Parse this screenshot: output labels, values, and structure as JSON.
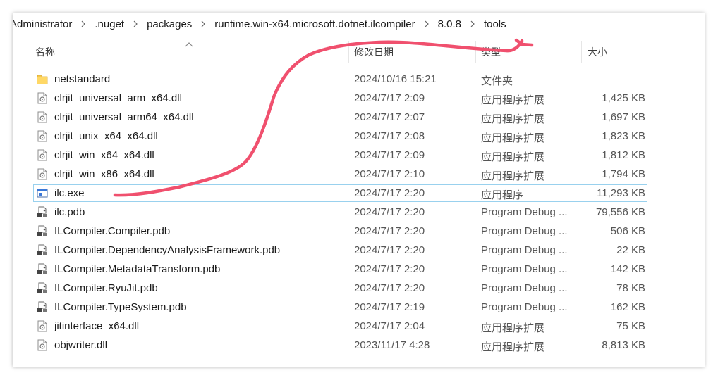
{
  "breadcrumb": [
    "Administrator",
    ".nuget",
    "packages",
    "runtime.win-x64.microsoft.dotnet.ilcompiler",
    "8.0.8",
    "tools"
  ],
  "columns": {
    "name": "名称",
    "date": "修改日期",
    "type": "类型",
    "size": "大小"
  },
  "files": [
    {
      "name": "netstandard",
      "date": "2024/10/16 15:21",
      "type": "文件夹",
      "size": "",
      "icon": "folder"
    },
    {
      "name": "clrjit_universal_arm_x64.dll",
      "date": "2024/7/17 2:09",
      "type": "应用程序扩展",
      "size": "1,425 KB",
      "icon": "dll"
    },
    {
      "name": "clrjit_universal_arm64_x64.dll",
      "date": "2024/7/17 2:07",
      "type": "应用程序扩展",
      "size": "1,697 KB",
      "icon": "dll"
    },
    {
      "name": "clrjit_unix_x64_x64.dll",
      "date": "2024/7/17 2:08",
      "type": "应用程序扩展",
      "size": "1,823 KB",
      "icon": "dll"
    },
    {
      "name": "clrjit_win_x64_x64.dll",
      "date": "2024/7/17 2:09",
      "type": "应用程序扩展",
      "size": "1,812 KB",
      "icon": "dll"
    },
    {
      "name": "clrjit_win_x86_x64.dll",
      "date": "2024/7/17 2:10",
      "type": "应用程序扩展",
      "size": "1,794 KB",
      "icon": "dll"
    },
    {
      "name": "ilc.exe",
      "date": "2024/7/17 2:20",
      "type": "应用程序",
      "size": "11,293 KB",
      "icon": "exe",
      "selected": true
    },
    {
      "name": "ilc.pdb",
      "date": "2024/7/17 2:20",
      "type": "Program Debug ...",
      "size": "79,556 KB",
      "icon": "pdb"
    },
    {
      "name": "ILCompiler.Compiler.pdb",
      "date": "2024/7/17 2:20",
      "type": "Program Debug ...",
      "size": "506 KB",
      "icon": "pdb"
    },
    {
      "name": "ILCompiler.DependencyAnalysisFramework.pdb",
      "date": "2024/7/17 2:20",
      "type": "Program Debug ...",
      "size": "22 KB",
      "icon": "pdb"
    },
    {
      "name": "ILCompiler.MetadataTransform.pdb",
      "date": "2024/7/17 2:20",
      "type": "Program Debug ...",
      "size": "142 KB",
      "icon": "pdb"
    },
    {
      "name": "ILCompiler.RyuJit.pdb",
      "date": "2024/7/17 2:20",
      "type": "Program Debug ...",
      "size": "78 KB",
      "icon": "pdb"
    },
    {
      "name": "ILCompiler.TypeSystem.pdb",
      "date": "2024/7/17 2:19",
      "type": "Program Debug ...",
      "size": "162 KB",
      "icon": "pdb"
    },
    {
      "name": "jitinterface_x64.dll",
      "date": "2024/7/17 2:04",
      "type": "应用程序扩展",
      "size": "75 KB",
      "icon": "dll"
    },
    {
      "name": "objwriter.dll",
      "date": "2023/11/17 4:28",
      "type": "应用程序扩展",
      "size": "8,813 KB",
      "icon": "dll"
    }
  ],
  "colors": {
    "annotation_stroke": "#f0506e",
    "selection_border": "#99d1ee",
    "folder": "#f4c74e"
  }
}
